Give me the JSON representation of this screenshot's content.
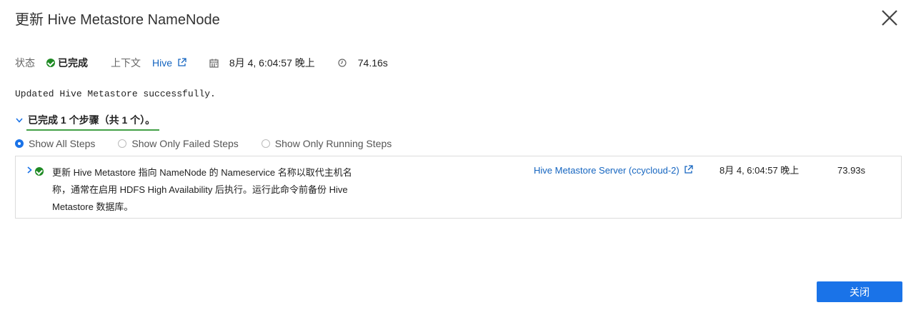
{
  "dialog": {
    "title": "更新 Hive Metastore NameNode",
    "close_icon": "close-icon"
  },
  "status": {
    "label": "状态",
    "value": "已完成",
    "value_icon": "check-circle-icon",
    "context_label": "上下文",
    "context_link": "Hive",
    "start_time": "8月 4, 6:04:57 晚上",
    "start_time_icon": "calendar-icon",
    "duration": "74.16s",
    "duration_icon": "clock-icon"
  },
  "message": "Updated Hive Metastore successfully.",
  "summary": {
    "text": "已完成 1 个步骤（共 1 个）。",
    "icon": "chevron-down-icon"
  },
  "filters": {
    "options": [
      "Show All Steps",
      "Show Only Failed Steps",
      "Show Only Running Steps"
    ],
    "selected": "Show All Steps"
  },
  "steps": [
    {
      "description": "更新 Hive Metastore 指向 NameNode 的 Nameservice 名称以取代主机名称，通常在启用 HDFS High Availability 后执行。运行此命令前备份 Hive Metastore 数据库。",
      "role_link": "Hive Metastore Server (ccycloud-2)",
      "time": "8月 4, 6:04:57 晚上",
      "duration": "73.93s",
      "status_icon": "check-circle-icon",
      "expand_icon": "chevron-right-icon"
    }
  ],
  "footer": {
    "close_button": "关闭"
  },
  "colors": {
    "accent": "#1a73e8",
    "link": "#1565c0",
    "success": "#1f8a24",
    "summary_underline": "#43a047"
  }
}
